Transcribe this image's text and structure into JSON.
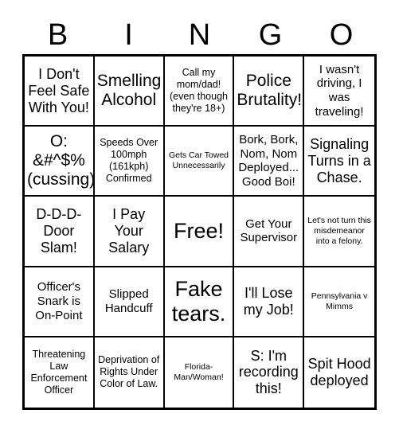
{
  "header": {
    "letters": [
      "B",
      "I",
      "N",
      "G",
      "O"
    ]
  },
  "grid": {
    "rows": [
      [
        {
          "text": "I Don't Feel Safe With You!",
          "size": "lg"
        },
        {
          "text": "Smelling Alcohol",
          "size": "xl"
        },
        {
          "text": "Call my mom/dad! (even though they're 18+)",
          "size": "sm"
        },
        {
          "text": "Police Brutality!",
          "size": "xl"
        },
        {
          "text": "I wasn't driving, I was traveling!",
          "size": "md"
        }
      ],
      [
        {
          "text": "O: &#^$% (cussing)",
          "size": "xl"
        },
        {
          "text": "Speeds Over 100mph (161kph) Confirmed",
          "size": "sm"
        },
        {
          "text": "Gets Car Towed Unnecessarily",
          "size": "xs"
        },
        {
          "text": "Bork, Bork, Nom, Nom Deployed... Good Boi!",
          "size": "md"
        },
        {
          "text": "Signaling Turns in a Chase.",
          "size": "lg"
        }
      ],
      [
        {
          "text": "D-D-D-Door Slam!",
          "size": "lg"
        },
        {
          "text": "I Pay Your Salary",
          "size": "lg"
        },
        {
          "text": "Free!",
          "size": "xxl"
        },
        {
          "text": "Get Your Supervisor",
          "size": "md"
        },
        {
          "text": "Let's not turn this misdemeanor into a felony.",
          "size": "xs"
        }
      ],
      [
        {
          "text": "Officer's Snark is On-Point",
          "size": "md"
        },
        {
          "text": "Slipped Handcuff",
          "size": "md"
        },
        {
          "text": "Fake tears.",
          "size": "xxl"
        },
        {
          "text": "I'll Lose my Job!",
          "size": "lg"
        },
        {
          "text": "Pennsylvania v Mimms",
          "size": "xs"
        }
      ],
      [
        {
          "text": "Threatening Law Enforcement Officer",
          "size": "sm"
        },
        {
          "text": "Deprivation of Rights Under Color of Law.",
          "size": "sm"
        },
        {
          "text": "Florida-Man/Woman!",
          "size": "xs"
        },
        {
          "text": "S: I'm recording this!",
          "size": "lg"
        },
        {
          "text": "Spit Hood deployed",
          "size": "lg"
        }
      ]
    ]
  },
  "colors": {
    "background": "#ffffff",
    "text": "#000000",
    "border": "#000000"
  }
}
